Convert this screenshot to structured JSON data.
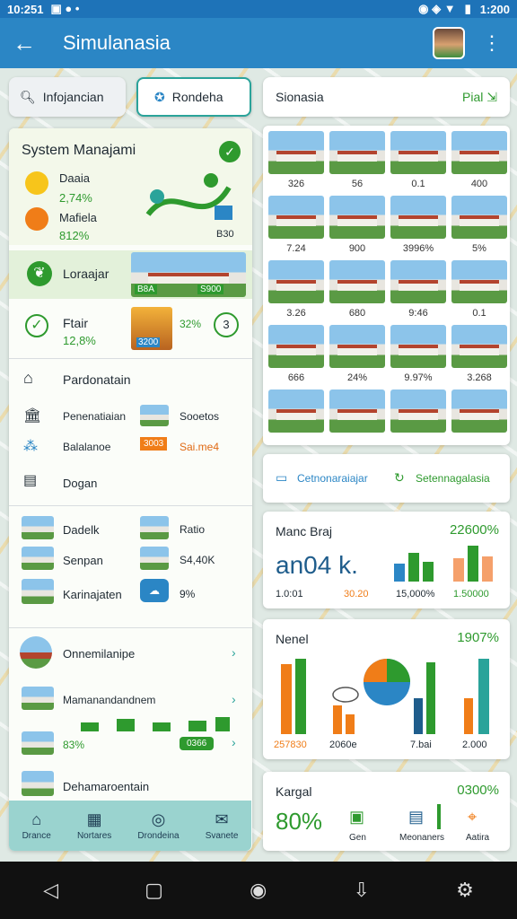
{
  "status": {
    "time_left": "10:251",
    "time_right": "1:200"
  },
  "appbar": {
    "title": "Simulanasia"
  },
  "search": {
    "left_label": "Infojancian",
    "mid_label": "Rondeha"
  },
  "panel_right_header": {
    "title": "Sionasia",
    "action": "Pial"
  },
  "system_card": {
    "title": "System Manajami",
    "items": [
      {
        "label": "Daaia",
        "value": "2,74%"
      },
      {
        "label": "Mafiela",
        "value": "812%"
      }
    ],
    "map_label": "B30"
  },
  "lorajar": {
    "label": "Loraajar",
    "img_left": "B8A",
    "img_right": "S900"
  },
  "ftair": {
    "label": "Ftair",
    "value": "12,8%",
    "img_value": "3200",
    "pct": "32%",
    "count": "3"
  },
  "menu": {
    "p_heading": "Pardonatain",
    "items": [
      "Penenatiaian",
      "Balalanoe",
      "Dogan"
    ],
    "side_items": [
      {
        "label": "Sooetos"
      },
      {
        "badge": "3003",
        "label": "Sai.me4"
      }
    ]
  },
  "list2": {
    "items": [
      {
        "label": "Dadelk",
        "side": "Ratio"
      },
      {
        "label": "Senpan",
        "side": "S4,40K"
      },
      {
        "label": "Karinajaten",
        "side": "9%"
      }
    ]
  },
  "list3": {
    "items": [
      {
        "label": "Onnemilanipe"
      },
      {
        "label": "Mamanandandnem",
        "pct": "83%",
        "badge": "0366"
      },
      {
        "label": "Dehamaroentain"
      }
    ]
  },
  "bottomtabs": [
    "Drance",
    "Nortares",
    "Drondeina",
    "Svanete"
  ],
  "gallery": {
    "values": [
      "326",
      "56",
      "0.1",
      "400",
      "7.24",
      "900",
      "3996%",
      "5%",
      "3.26",
      "680",
      "9:46",
      "0.1",
      "666",
      "24%",
      "9.97%",
      "3.268"
    ]
  },
  "action_card": {
    "left": "Cetnonaraiajar",
    "right": "Setennagalasia"
  },
  "stats1": {
    "title": "Manc Braj",
    "pct": "22600%",
    "big": "an04 k.",
    "foot": [
      "1.0:01",
      "30.20",
      "15,000%",
      "1.50000"
    ]
  },
  "stats2": {
    "title": "Nenel",
    "pct": "1907%",
    "foot": [
      "257830",
      "2060e",
      "7.bai",
      "2.000"
    ]
  },
  "stats3": {
    "title": "Kargal",
    "pct": "0300%",
    "big": "80%",
    "items": [
      "Gen",
      "Meonaners",
      "Aatira"
    ]
  },
  "colors": {
    "accent": "#2b86c5",
    "green": "#2e9a2e",
    "orange": "#f07d18"
  }
}
